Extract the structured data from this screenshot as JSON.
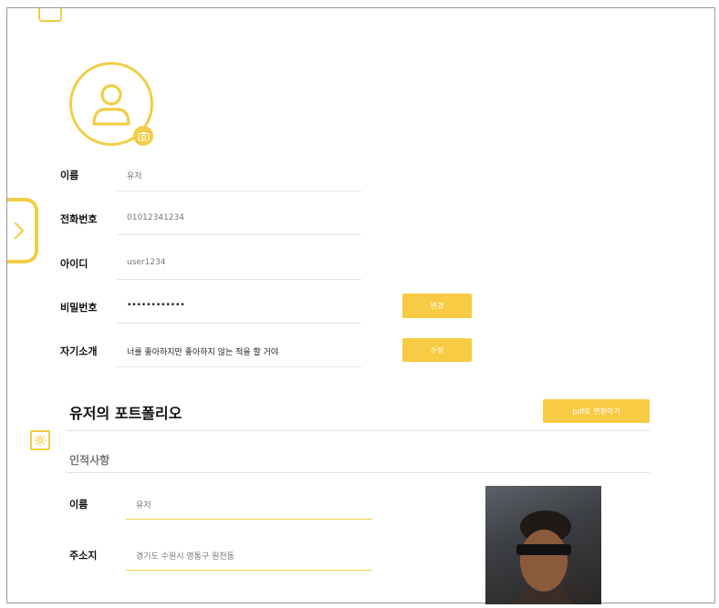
{
  "profile": {
    "fields": [
      {
        "label": "이름",
        "value": "유저"
      },
      {
        "label": "전화번호",
        "value": "01012341234"
      },
      {
        "label": "아이디",
        "value": "user1234"
      },
      {
        "label": "비밀번호",
        "value": "••••••••••••"
      },
      {
        "label": "자기소개",
        "value": "너를 좋아하지만 좋아하지 않는 척을 할 거야"
      }
    ],
    "change_password_label": "변경",
    "edit_intro_label": "수정"
  },
  "portfolio": {
    "title": "유저의 포트폴리오",
    "pdf_button_label": "pdf로 변환하기",
    "section_title": "인적사항",
    "fields": [
      {
        "label": "이름",
        "value": "유저"
      },
      {
        "label": "주소지",
        "value": "경기도 수원시 영통구 원천동"
      }
    ]
  },
  "icons": {
    "avatar": "user-icon",
    "camera": "camera-icon",
    "expand": "chevron-right-icon",
    "settings": "gear-icon"
  },
  "colors": {
    "accent": "#f7cb44",
    "border": "#f2cd45"
  }
}
